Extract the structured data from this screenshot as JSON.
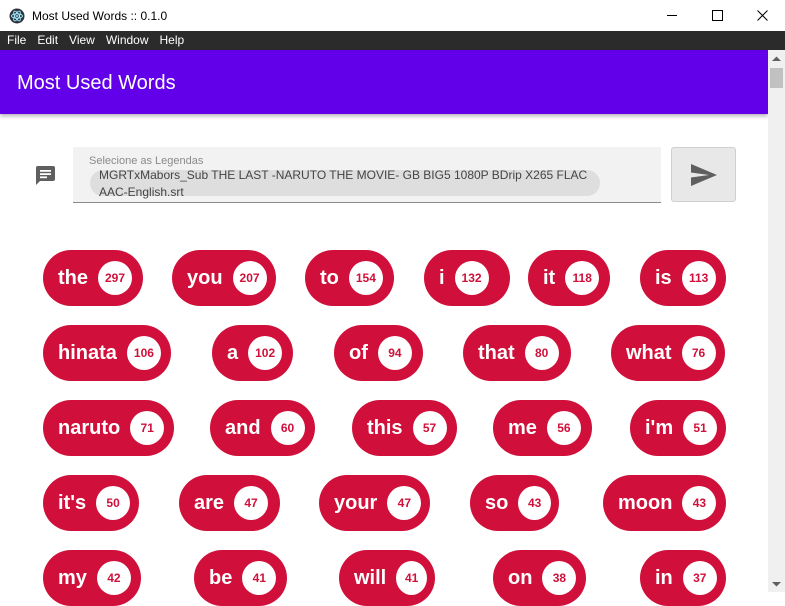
{
  "window": {
    "title": "Most Used Words :: 0.1.0"
  },
  "menu": [
    "File",
    "Edit",
    "View",
    "Window",
    "Help"
  ],
  "appbar": {
    "title": "Most Used Words"
  },
  "file_input": {
    "label": "Selecione as Legendas",
    "value": "MGRTxMabors_Sub THE LAST -NARUTO THE MOVIE- GB BIG5 1080P BDrip X265 FLAC AAC-English.srt"
  },
  "colors": {
    "appbar": "#6200ea",
    "chip": "#d0103a"
  },
  "words": [
    {
      "word": "the",
      "count": "297"
    },
    {
      "word": "you",
      "count": "207"
    },
    {
      "word": "to",
      "count": "154"
    },
    {
      "word": "i",
      "count": "132"
    },
    {
      "word": "it",
      "count": "118"
    },
    {
      "word": "is",
      "count": "113"
    },
    {
      "word": "hinata",
      "count": "106"
    },
    {
      "word": "a",
      "count": "102"
    },
    {
      "word": "of",
      "count": "94"
    },
    {
      "word": "that",
      "count": "80"
    },
    {
      "word": "what",
      "count": "76"
    },
    {
      "word": "naruto",
      "count": "71"
    },
    {
      "word": "and",
      "count": "60"
    },
    {
      "word": "this",
      "count": "57"
    },
    {
      "word": "me",
      "count": "56"
    },
    {
      "word": "i'm",
      "count": "51"
    },
    {
      "word": "it's",
      "count": "50"
    },
    {
      "word": "are",
      "count": "47"
    },
    {
      "word": "your",
      "count": "47"
    },
    {
      "word": "so",
      "count": "43"
    },
    {
      "word": "moon",
      "count": "43"
    },
    {
      "word": "my",
      "count": "42"
    },
    {
      "word": "be",
      "count": "41"
    },
    {
      "word": "will",
      "count": "41"
    },
    {
      "word": "on",
      "count": "38"
    },
    {
      "word": "in",
      "count": "37"
    }
  ]
}
